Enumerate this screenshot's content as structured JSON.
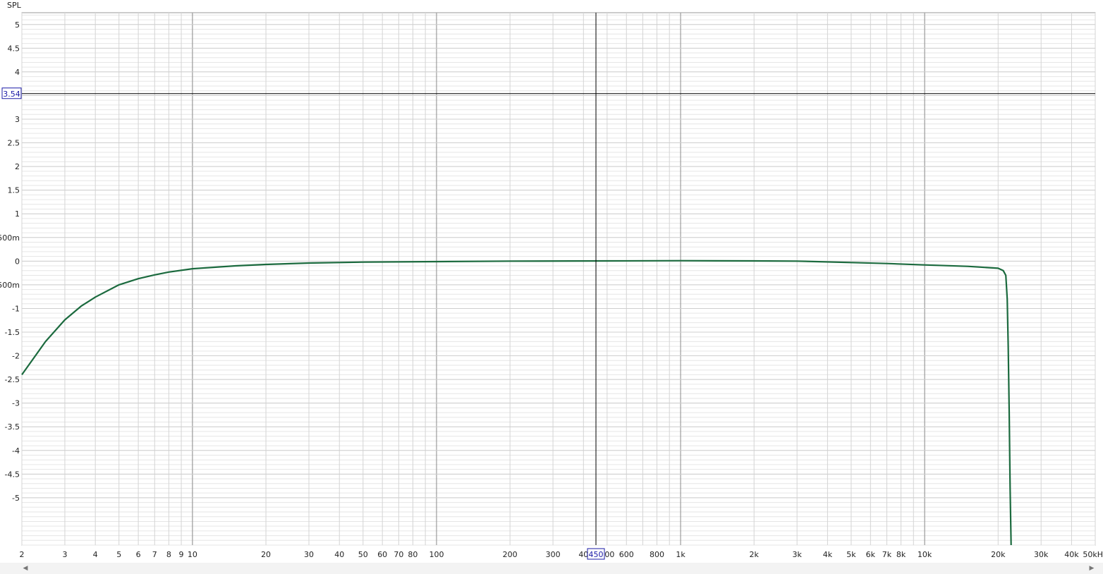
{
  "chart_data": {
    "type": "line",
    "ylabel": "SPL",
    "x_scale": "log",
    "xlim": [
      2,
      50000
    ],
    "ylim": [
      -6.0,
      5.25
    ],
    "grid": true,
    "line_color": "#1b6a3e",
    "y_ticks": [
      {
        "value": 5,
        "label": "5"
      },
      {
        "value": 4.5,
        "label": "4.5"
      },
      {
        "value": 4,
        "label": "4"
      },
      {
        "value": 3.5,
        "label": "3.5"
      },
      {
        "value": 3,
        "label": "3"
      },
      {
        "value": 2.5,
        "label": "2.5"
      },
      {
        "value": 2,
        "label": "2"
      },
      {
        "value": 1.5,
        "label": "1.5"
      },
      {
        "value": 1,
        "label": "1"
      },
      {
        "value": 0.5,
        "label": "500m"
      },
      {
        "value": 0,
        "label": "0"
      },
      {
        "value": -0.5,
        "label": "-500m"
      },
      {
        "value": -1,
        "label": "-1"
      },
      {
        "value": -1.5,
        "label": "-1.5"
      },
      {
        "value": -2,
        "label": "-2"
      },
      {
        "value": -2.5,
        "label": "-2.5"
      },
      {
        "value": -3,
        "label": "-3"
      },
      {
        "value": -3.5,
        "label": "-3.5"
      },
      {
        "value": -4,
        "label": "-4"
      },
      {
        "value": -4.5,
        "label": "-4.5"
      },
      {
        "value": -5,
        "label": "-5"
      }
    ],
    "x_ticks": [
      {
        "value": 2,
        "label": "2"
      },
      {
        "value": 3,
        "label": "3"
      },
      {
        "value": 4,
        "label": "4"
      },
      {
        "value": 5,
        "label": "5"
      },
      {
        "value": 6,
        "label": "6"
      },
      {
        "value": 7,
        "label": "7"
      },
      {
        "value": 8,
        "label": "8"
      },
      {
        "value": 9,
        "label": "9"
      },
      {
        "value": 10,
        "label": "10"
      },
      {
        "value": 20,
        "label": "20"
      },
      {
        "value": 30,
        "label": "30"
      },
      {
        "value": 40,
        "label": "40"
      },
      {
        "value": 50,
        "label": "50"
      },
      {
        "value": 60,
        "label": "60"
      },
      {
        "value": 70,
        "label": "70"
      },
      {
        "value": 80,
        "label": "80"
      },
      {
        "value": 100,
        "label": "100"
      },
      {
        "value": 200,
        "label": "200"
      },
      {
        "value": 300,
        "label": "300"
      },
      {
        "value": 400,
        "label": "40"
      },
      {
        "value": 500,
        "label": "500"
      },
      {
        "value": 600,
        "label": "600"
      },
      {
        "value": 800,
        "label": "800"
      },
      {
        "value": 1000,
        "label": "1k"
      },
      {
        "value": 2000,
        "label": "2k"
      },
      {
        "value": 3000,
        "label": "3k"
      },
      {
        "value": 4000,
        "label": "4k"
      },
      {
        "value": 5000,
        "label": "5k"
      },
      {
        "value": 6000,
        "label": "6k"
      },
      {
        "value": 7000,
        "label": "7k"
      },
      {
        "value": 8000,
        "label": "8k"
      },
      {
        "value": 10000,
        "label": "10k"
      },
      {
        "value": 20000,
        "label": "20k"
      },
      {
        "value": 30000,
        "label": "30k"
      },
      {
        "value": 40000,
        "label": "40k"
      },
      {
        "value": 50000,
        "label": "50kH"
      }
    ],
    "cursor": {
      "x": 450,
      "y": 3.54,
      "x_label": "450",
      "y_label": "3.54"
    },
    "series": [
      {
        "x": [
          2,
          2.5,
          3,
          3.5,
          4,
          5,
          6,
          7,
          8,
          10,
          15,
          20,
          30,
          50,
          100,
          200,
          500,
          1000,
          2000,
          3000,
          5000,
          7000,
          10000,
          15000,
          20000,
          21000,
          21500,
          21800,
          22000,
          22200,
          22400,
          22600
        ],
        "y": [
          -2.4,
          -1.7,
          -1.24,
          -0.95,
          -0.76,
          -0.5,
          -0.37,
          -0.29,
          -0.23,
          -0.16,
          -0.1,
          -0.07,
          -0.04,
          -0.02,
          -0.01,
          0.0,
          0.005,
          0.01,
          0.005,
          0.0,
          -0.03,
          -0.05,
          -0.08,
          -0.11,
          -0.15,
          -0.2,
          -0.3,
          -0.8,
          -1.8,
          -3.2,
          -4.8,
          -6.0
        ]
      }
    ]
  }
}
